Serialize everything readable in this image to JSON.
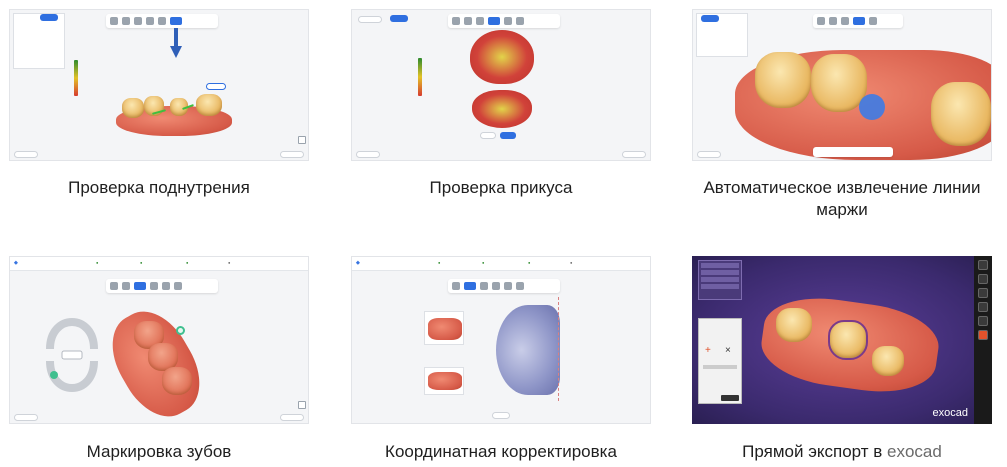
{
  "captions": {
    "undercut": "Проверка поднутрения",
    "bite": "Проверка прикуса",
    "margin_line": "Автоматическое извлечение линии маржи",
    "tooth_marking": "Маркировка зубов",
    "coordinate": "Координатная корректировка",
    "export_prefix": "Прямой экспорт в ",
    "export_brand": "exocad"
  },
  "exocad_logo": "exocad",
  "colors": {
    "accent": "#2f6fe0",
    "gum": "#d65a48",
    "tooth": "#e9b862",
    "exocad_bg": "#3b2a6e"
  }
}
